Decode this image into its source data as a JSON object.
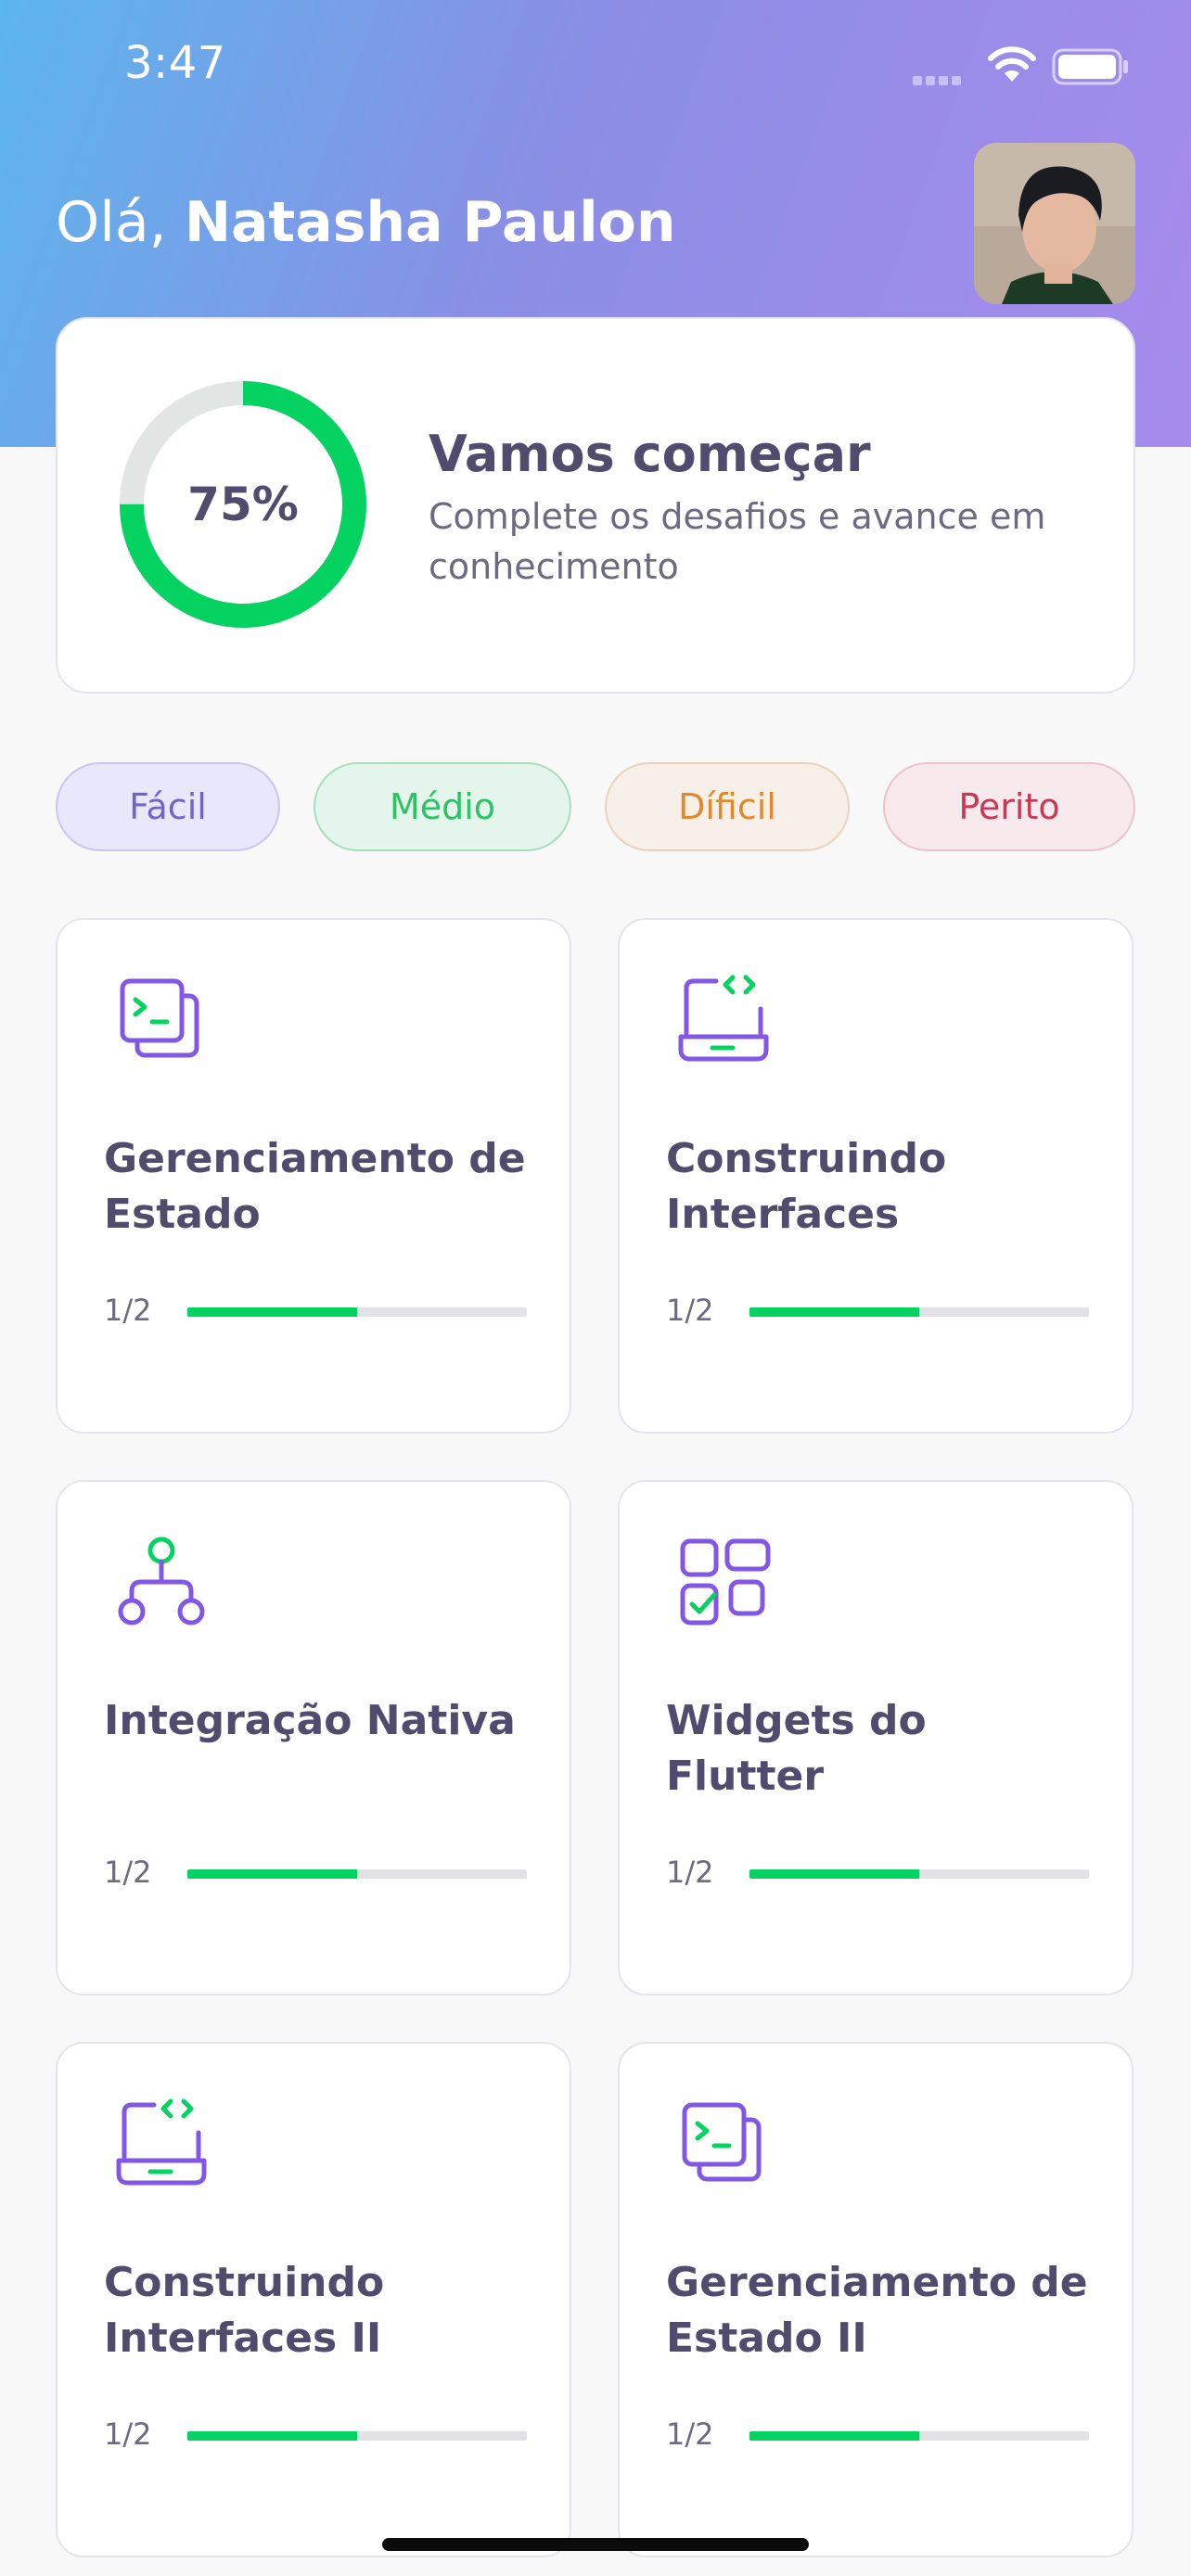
{
  "status_bar": {
    "time": "3:47"
  },
  "header": {
    "greeting": "Olá,",
    "user_name": "Natasha Paulon"
  },
  "progress_card": {
    "percent_label": "75%",
    "percent_value": 75,
    "title": "Vamos começar",
    "subtitle": "Complete os desafios e avance em conhecimento"
  },
  "filters": [
    "Fácil",
    "Médio",
    "Díficil",
    "Perito"
  ],
  "challenges": [
    {
      "title": "Gerenciamento de Estado",
      "count": "1/2",
      "progress": 0.5,
      "icon": "terminal-icon"
    },
    {
      "title": "Construindo Interfaces",
      "count": "1/2",
      "progress": 0.5,
      "icon": "laptop-code-icon"
    },
    {
      "title": "Integração Nativa",
      "count": "1/2",
      "progress": 0.5,
      "icon": "hierarchy-icon"
    },
    {
      "title": "Widgets do Flutter",
      "count": "1/2",
      "progress": 0.5,
      "icon": "widgets-icon"
    },
    {
      "title": "Construindo Interfaces II",
      "count": "1/2",
      "progress": 0.5,
      "icon": "laptop-code-icon"
    },
    {
      "title": "Gerenciamento de Estado II",
      "count": "1/2",
      "progress": 0.5,
      "icon": "terminal-icon"
    }
  ],
  "colors": {
    "accent_green": "#04d361",
    "accent_purple": "#8257e5",
    "ring_track": "#e1e5e4",
    "text_primary": "#514c6d"
  }
}
